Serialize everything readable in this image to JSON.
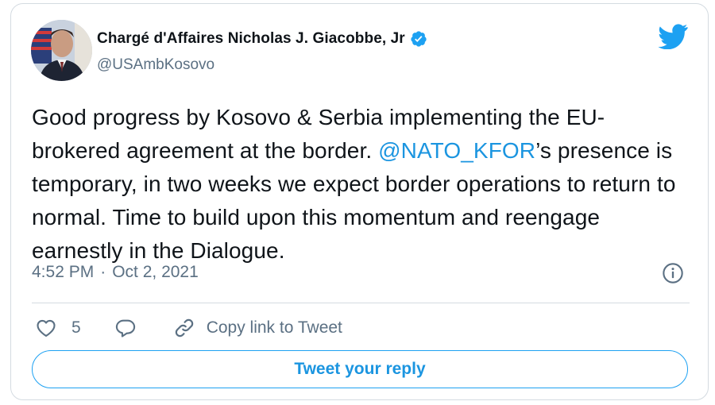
{
  "author": {
    "display_name": "Chargé d'Affaires Nicholas J. Giacobbe, Jr",
    "handle": "@USAmbKosovo",
    "verified_icon": "verified-badge-icon",
    "avatar": "avatar"
  },
  "tweet": {
    "text_part1": "Good progress by Kosovo & Serbia implementing the EU-brokered agreement at the border. ",
    "mention": "@NATO_KFOR",
    "text_part2": "’s presence is temporary, in two weeks we expect border operations to return to normal. Time to build upon this momentum and reengage earnestly in the Dialogue."
  },
  "meta": {
    "time": "4:52 PM",
    "separator": "·",
    "date": "Oct 2, 2021"
  },
  "actions": {
    "like_count": "5",
    "copy_link_label": "Copy link to Tweet"
  },
  "reply_button": {
    "label": "Tweet your reply"
  },
  "colors": {
    "accent": "#1da1f2",
    "mention": "#1b95e0",
    "secondary_text": "#5b7083",
    "border": "#d4dbe1"
  }
}
